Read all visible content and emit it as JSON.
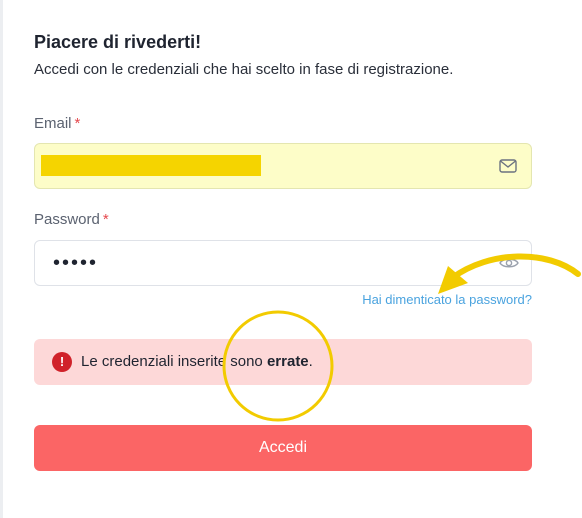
{
  "header": {
    "title": "Piacere di rivederti!",
    "subtitle": "Accedi con le credenziali che hai scelto in fase di registrazione."
  },
  "form": {
    "email": {
      "label": "Email",
      "required_mark": "*",
      "value": "",
      "icon": "mail-icon",
      "autofill_background": "#fdfdc8",
      "redaction_color": "#f5d400"
    },
    "password": {
      "label": "Password",
      "required_mark": "*",
      "value": "•••••",
      "icon": "eye-icon"
    },
    "forgot_link": "Hai dimenticato la password?",
    "error": {
      "icon": "exclamation-icon",
      "glyph": "!",
      "text_before": "Le credenziali inserite sono ",
      "text_bold": "errate",
      "text_after": ".",
      "background": "#fdd8d8"
    },
    "submit_label": "Accedi",
    "submit_color": "#fb6565"
  },
  "annotations": {
    "color": "#f2cb00",
    "items": [
      "circle-annotation",
      "arrow-annotation"
    ]
  },
  "colors": {
    "required": "#e5484d",
    "link": "#4aa3df",
    "error_icon": "#d0222a"
  }
}
